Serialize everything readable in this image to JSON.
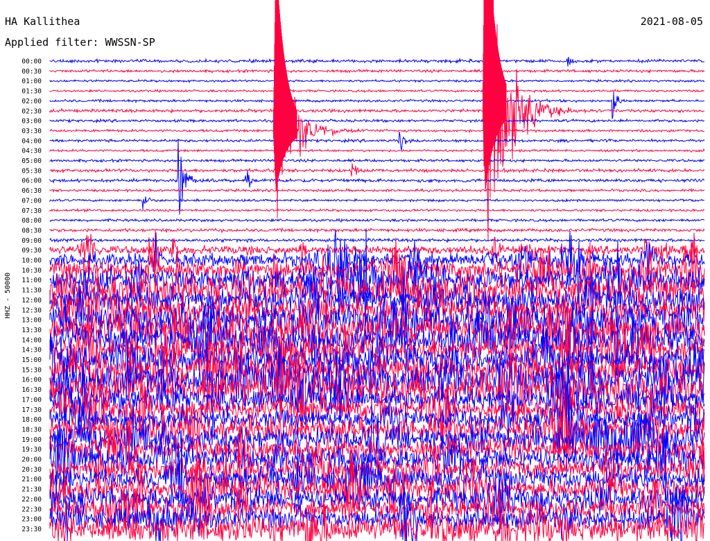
{
  "header": {
    "station": "HA Kallithea",
    "date": "2021-08-05",
    "filter": "Applied filter: WWSSN-SP"
  },
  "chart_data": {
    "type": "line",
    "title": "HA Kallithea",
    "subtitle": "Applied filter: WWSSN-SP",
    "date": "2021-08-05",
    "ylabel": "HHZ - 50000",
    "rows": [
      "00:00",
      "00:30",
      "01:00",
      "01:30",
      "02:00",
      "02:30",
      "03:00",
      "03:30",
      "04:00",
      "04:30",
      "05:00",
      "05:30",
      "06:00",
      "06:30",
      "07:00",
      "07:30",
      "08:00",
      "08:30",
      "09:00",
      "09:30",
      "10:00",
      "10:30",
      "11:00",
      "11:30",
      "12:00",
      "12:30",
      "13:00",
      "13:30",
      "14:00",
      "14:30",
      "15:00",
      "15:30",
      "16:00",
      "16:30",
      "17:00",
      "17:30",
      "18:00",
      "18:30",
      "19:00",
      "19:30",
      "20:00",
      "20:30",
      "21:00",
      "21:30",
      "22:00",
      "22:30",
      "23:00",
      "23:30"
    ],
    "trace_colors": [
      "#0000ff",
      "#ff0040"
    ],
    "grid": false
  }
}
